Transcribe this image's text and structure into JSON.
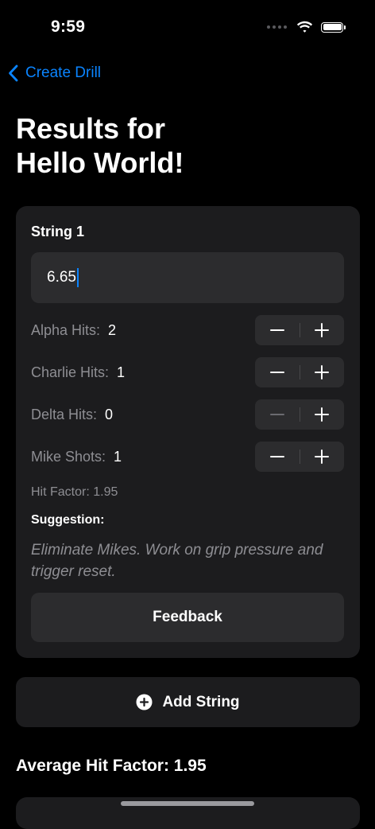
{
  "status_bar": {
    "time": "9:59",
    "battery_level": 1.0
  },
  "nav": {
    "back_label": "Create Drill"
  },
  "page": {
    "title_line1": "Results for",
    "title_line2": "Hello World!"
  },
  "string_card": {
    "heading": "String 1",
    "time_value": "6.65",
    "counters": [
      {
        "label": "Alpha Hits:",
        "value": "2"
      },
      {
        "label": "Charlie Hits:",
        "value": "1"
      },
      {
        "label": "Delta Hits:",
        "value": "0"
      },
      {
        "label": "Mike Shots:",
        "value": "1"
      }
    ],
    "hit_factor": "Hit Factor: 1.95",
    "suggestion_heading": "Suggestion:",
    "suggestion_text": "Eliminate Mikes. Work on grip pressure and trigger reset.",
    "feedback_label": "Feedback"
  },
  "add_string": {
    "label": "Add String",
    "icon": "plus-circle-icon"
  },
  "summary": {
    "average": "Average Hit Factor: 1.95"
  },
  "colors": {
    "accent": "#0a84ff",
    "background": "#000000",
    "card": "#1c1c1e",
    "control": "#2c2c2e",
    "secondary_text": "#8e8e93"
  }
}
